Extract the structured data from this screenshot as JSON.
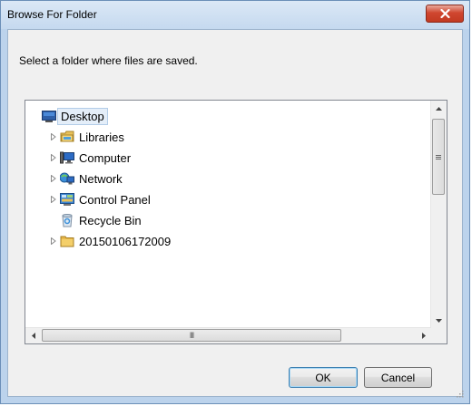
{
  "window": {
    "title": "Browse For Folder"
  },
  "instruction": "Select a folder where files are saved.",
  "tree": {
    "items": [
      {
        "label": "Desktop",
        "icon": "desktop-icon",
        "expandable": false,
        "selected": true
      },
      {
        "label": "Libraries",
        "icon": "libraries-icon",
        "expandable": true,
        "selected": false
      },
      {
        "label": "Computer",
        "icon": "computer-icon",
        "expandable": true,
        "selected": false
      },
      {
        "label": "Network",
        "icon": "network-icon",
        "expandable": true,
        "selected": false
      },
      {
        "label": "Control Panel",
        "icon": "control-panel-icon",
        "expandable": true,
        "selected": false
      },
      {
        "label": "Recycle Bin",
        "icon": "recycle-bin-icon",
        "expandable": false,
        "selected": false
      },
      {
        "label": "20150106172009",
        "icon": "folder-icon",
        "expandable": true,
        "selected": false
      }
    ]
  },
  "scrollbar": {
    "h_thumb_grip": "III"
  },
  "buttons": {
    "ok": "OK",
    "cancel": "Cancel"
  },
  "colors": {
    "title_bar": "#c5d9ef",
    "close_button": "#c94a32",
    "selection": "#e4eef9"
  }
}
